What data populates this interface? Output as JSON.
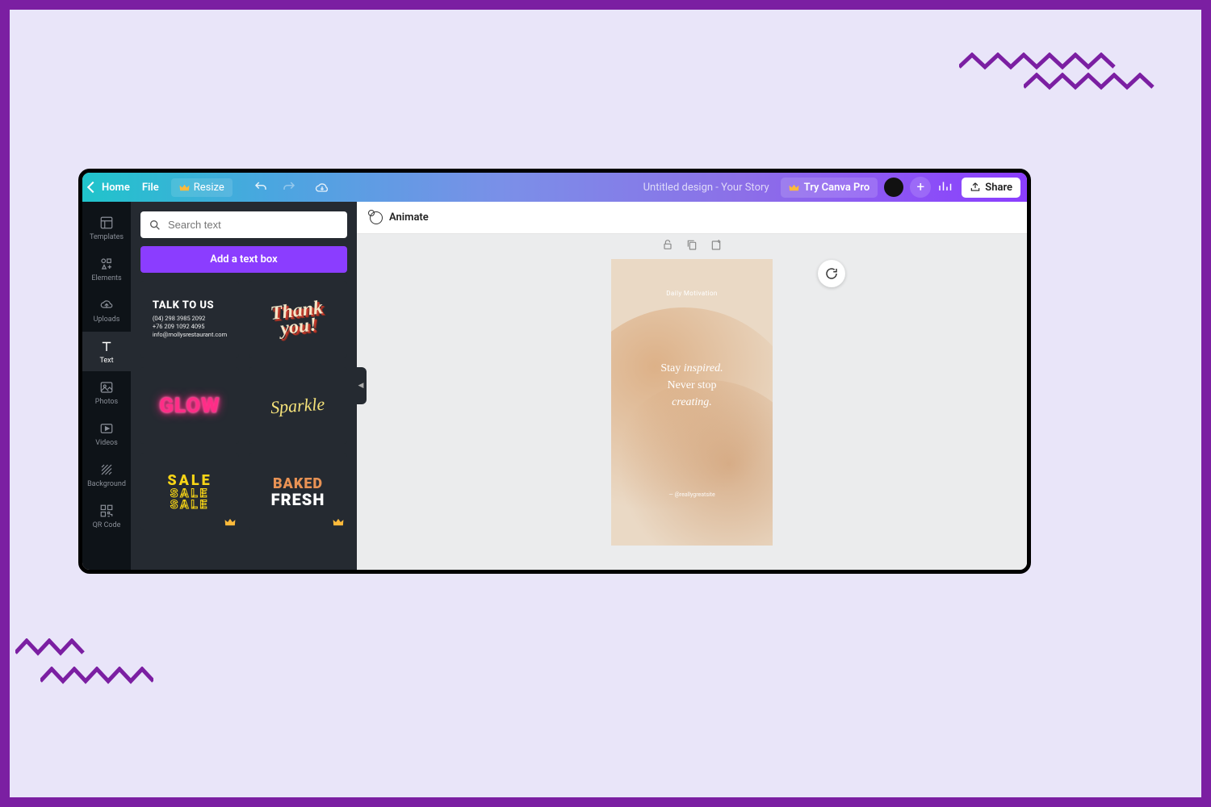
{
  "topbar": {
    "home": "Home",
    "file": "File",
    "resize": "Resize",
    "title": "Untitled design - Your Story",
    "try_pro": "Try Canva Pro",
    "share": "Share"
  },
  "rail": {
    "items": [
      {
        "id": "templates",
        "label": "Templates"
      },
      {
        "id": "elements",
        "label": "Elements"
      },
      {
        "id": "uploads",
        "label": "Uploads"
      },
      {
        "id": "text",
        "label": "Text"
      },
      {
        "id": "photos",
        "label": "Photos"
      },
      {
        "id": "videos",
        "label": "Videos"
      },
      {
        "id": "background",
        "label": "Background"
      },
      {
        "id": "qr",
        "label": "QR Code"
      }
    ],
    "active": "text"
  },
  "panel": {
    "search_placeholder": "Search text",
    "add_text": "Add a text box",
    "templates": {
      "talk": {
        "heading": "TALK TO US",
        "line1": "(04) 298 3985 2092",
        "line2": "+76 209 1092 4095",
        "line3": "info@mollysrestaurant.com"
      },
      "thank": {
        "line1": "Thank",
        "line2": "you!"
      },
      "glow": "GLOW",
      "sparkle": "Sparkle",
      "sale": "SALE",
      "baked": {
        "line1": "BAKED",
        "line2": "FRESH"
      }
    }
  },
  "context": {
    "animate": "Animate"
  },
  "canvas": {
    "subtitle": "Daily Motivation",
    "line1a": "Stay ",
    "line1b": "inspired.",
    "line2": "Never stop",
    "line3": "creating.",
    "handle": "— @reallygreatsite"
  }
}
